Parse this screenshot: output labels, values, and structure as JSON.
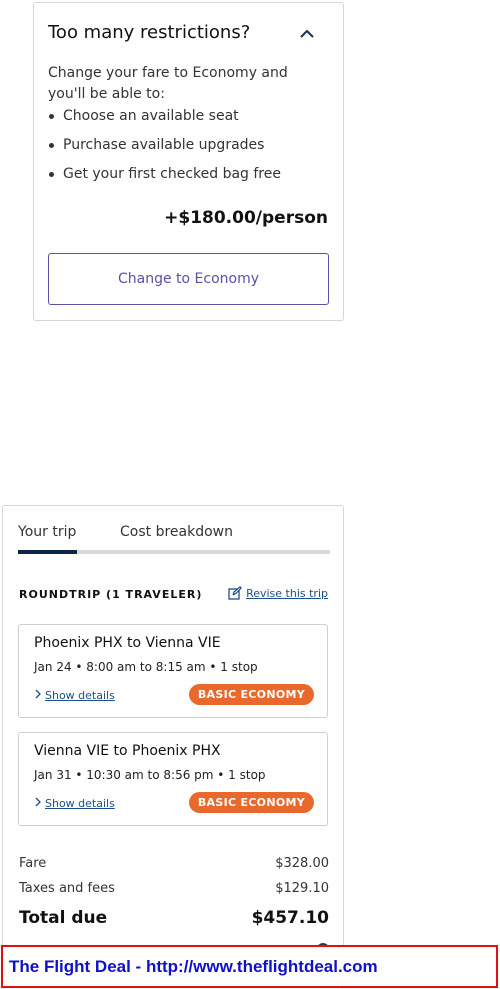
{
  "upsell": {
    "title": "Too many restrictions?",
    "description": "Change your fare to Economy and you'll be able to:",
    "benefits": [
      "Choose an available seat",
      "Purchase available upgrades",
      "Get your first checked bag free"
    ],
    "price": "+$180.00/person",
    "cta_label": "Change to Economy"
  },
  "summary": {
    "tabs": [
      {
        "label": "Your trip",
        "active": true
      },
      {
        "label": "Cost breakdown",
        "active": false
      }
    ],
    "trip_type": "ROUNDTRIP (1 TRAVELER)",
    "revise_label": "Revise this trip",
    "flights": [
      {
        "route": "Phoenix PHX to Vienna VIE",
        "when": "Jan 24 • 8:00 am to 8:15 am • 1 stop",
        "details_label": "Show details",
        "fare_badge": "BASIC ECONOMY"
      },
      {
        "route": "Vienna VIE to Phoenix PHX",
        "when": "Jan 31 • 10:30 am to 8:56 pm • 1 stop",
        "details_label": "Show details",
        "fare_badge": "BASIC ECONOMY"
      }
    ],
    "costs": {
      "fare_label": "Fare",
      "fare_value": "$328.00",
      "taxes_label": "Taxes and fees",
      "taxes_value": "$129.10",
      "total_label": "Total due",
      "total_value": "$457.10"
    }
  },
  "watermark": {
    "text": "The Flight Deal - http://www.theflightdeal.com"
  },
  "colors": {
    "accent": "#5b50a8",
    "badge": "#e8692b",
    "link": "#1b4f8a",
    "tab_active": "#0b2545",
    "watermark_border": "#e01010",
    "watermark_text": "#1010c8"
  },
  "icons": {
    "collapse": "chevron-up-icon",
    "revise": "edit-icon",
    "details": "chevron-right-icon"
  }
}
